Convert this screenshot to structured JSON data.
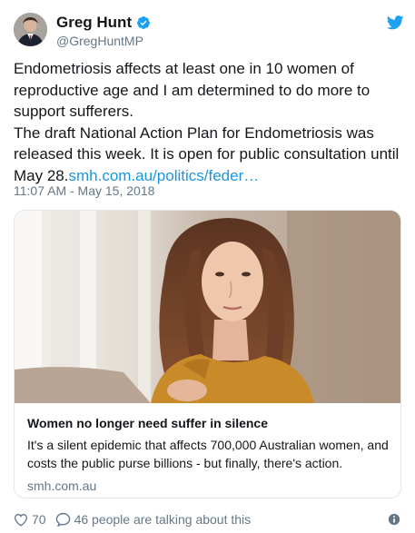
{
  "author": {
    "name": "Greg Hunt",
    "handle": "@GregHuntMP"
  },
  "tweet": {
    "lines": [
      "Endometriosis affects at least one in 10 women of reproductive age and I am determined to do more to support sufferers.",
      "The draft National Action Plan for Endometriosis was released this week. It is open for public consultation until May 28."
    ],
    "link_text": "smh.com.au/politics/feder…",
    "timestamp": "11:07 AM - May 15, 2018"
  },
  "card": {
    "title": "Women no longer need suffer in silence",
    "description": "It's a silent epidemic that affects 700,000 Australian women, and costs the public purse billions - but finally, there's action.",
    "domain": "smh.com.au"
  },
  "footer": {
    "likes": "70",
    "talking": "46 people are talking about this"
  },
  "colors": {
    "link": "#1b95e0",
    "muted": "#657786",
    "verified": "#1da1f2",
    "twitter_bird": "#1da1f2"
  },
  "icons": [
    "verified-badge-icon",
    "twitter-bird-icon",
    "heart-icon",
    "comment-bubble-icon",
    "info-icon"
  ]
}
